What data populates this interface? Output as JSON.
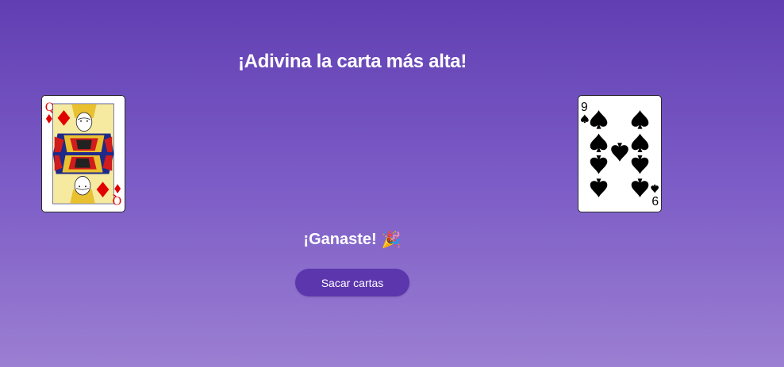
{
  "title": "¡Adivina la carta más alta!",
  "cards": {
    "left": {
      "rank": "Q",
      "suit": "diamonds",
      "suit_symbol": "♦",
      "color": "#e00000"
    },
    "right": {
      "rank": "9",
      "suit": "spades",
      "suit_symbol": "♠",
      "color": "#000000"
    }
  },
  "result": {
    "text": "¡Ganaste!",
    "emoji": "🎉"
  },
  "draw_button": {
    "label": "Sacar cartas"
  },
  "colors": {
    "background_top": "#613fb3",
    "background_bottom": "#9b7fd2",
    "button": "#5b36ad"
  }
}
